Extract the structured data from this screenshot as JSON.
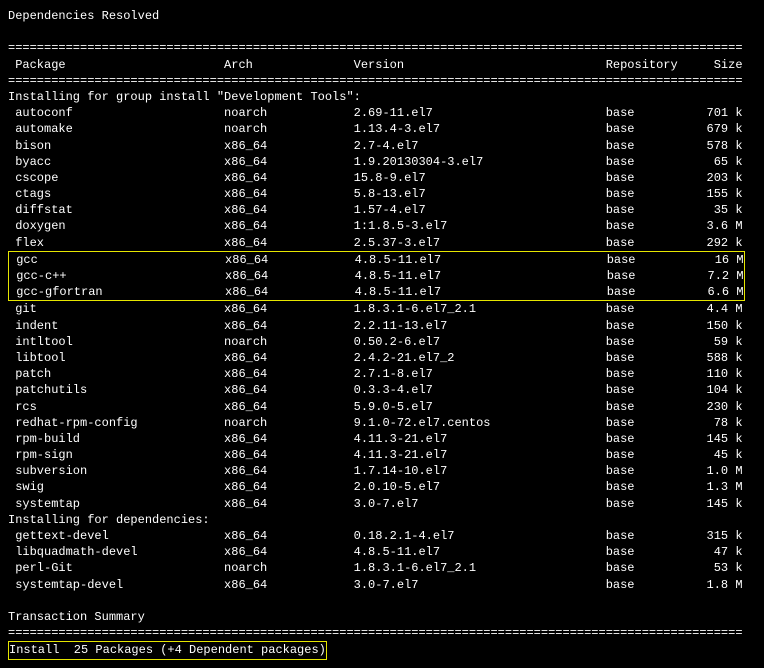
{
  "header": {
    "resolved": "Dependencies Resolved"
  },
  "columns": {
    "package": "Package",
    "arch": "Arch",
    "version": "Version",
    "repository": "Repository",
    "size": "Size"
  },
  "sections": {
    "install_group": "Installing for group install \"Development Tools\":",
    "install_deps": "Installing for dependencies:"
  },
  "packages_main": [
    {
      "name": "autoconf",
      "arch": "noarch",
      "version": "2.69-11.el7",
      "repo": "base",
      "size": "701 k"
    },
    {
      "name": "automake",
      "arch": "noarch",
      "version": "1.13.4-3.el7",
      "repo": "base",
      "size": "679 k"
    },
    {
      "name": "bison",
      "arch": "x86_64",
      "version": "2.7-4.el7",
      "repo": "base",
      "size": "578 k"
    },
    {
      "name": "byacc",
      "arch": "x86_64",
      "version": "1.9.20130304-3.el7",
      "repo": "base",
      "size": "65 k"
    },
    {
      "name": "cscope",
      "arch": "x86_64",
      "version": "15.8-9.el7",
      "repo": "base",
      "size": "203 k"
    },
    {
      "name": "ctags",
      "arch": "x86_64",
      "version": "5.8-13.el7",
      "repo": "base",
      "size": "155 k"
    },
    {
      "name": "diffstat",
      "arch": "x86_64",
      "version": "1.57-4.el7",
      "repo": "base",
      "size": "35 k"
    },
    {
      "name": "doxygen",
      "arch": "x86_64",
      "version": "1:1.8.5-3.el7",
      "repo": "base",
      "size": "3.6 M"
    },
    {
      "name": "flex",
      "arch": "x86_64",
      "version": "2.5.37-3.el7",
      "repo": "base",
      "size": "292 k"
    }
  ],
  "packages_highlight": [
    {
      "name": "gcc",
      "arch": "x86_64",
      "version": "4.8.5-11.el7",
      "repo": "base",
      "size": "16 M"
    },
    {
      "name": "gcc-c++",
      "arch": "x86_64",
      "version": "4.8.5-11.el7",
      "repo": "base",
      "size": "7.2 M"
    },
    {
      "name": "gcc-gfortran",
      "arch": "x86_64",
      "version": "4.8.5-11.el7",
      "repo": "base",
      "size": "6.6 M"
    }
  ],
  "packages_main2": [
    {
      "name": "git",
      "arch": "x86_64",
      "version": "1.8.3.1-6.el7_2.1",
      "repo": "base",
      "size": "4.4 M"
    },
    {
      "name": "indent",
      "arch": "x86_64",
      "version": "2.2.11-13.el7",
      "repo": "base",
      "size": "150 k"
    },
    {
      "name": "intltool",
      "arch": "noarch",
      "version": "0.50.2-6.el7",
      "repo": "base",
      "size": "59 k"
    },
    {
      "name": "libtool",
      "arch": "x86_64",
      "version": "2.4.2-21.el7_2",
      "repo": "base",
      "size": "588 k"
    },
    {
      "name": "patch",
      "arch": "x86_64",
      "version": "2.7.1-8.el7",
      "repo": "base",
      "size": "110 k"
    },
    {
      "name": "patchutils",
      "arch": "x86_64",
      "version": "0.3.3-4.el7",
      "repo": "base",
      "size": "104 k"
    },
    {
      "name": "rcs",
      "arch": "x86_64",
      "version": "5.9.0-5.el7",
      "repo": "base",
      "size": "230 k"
    },
    {
      "name": "redhat-rpm-config",
      "arch": "noarch",
      "version": "9.1.0-72.el7.centos",
      "repo": "base",
      "size": "78 k"
    },
    {
      "name": "rpm-build",
      "arch": "x86_64",
      "version": "4.11.3-21.el7",
      "repo": "base",
      "size": "145 k"
    },
    {
      "name": "rpm-sign",
      "arch": "x86_64",
      "version": "4.11.3-21.el7",
      "repo": "base",
      "size": "45 k"
    },
    {
      "name": "subversion",
      "arch": "x86_64",
      "version": "1.7.14-10.el7",
      "repo": "base",
      "size": "1.0 M"
    },
    {
      "name": "swig",
      "arch": "x86_64",
      "version": "2.0.10-5.el7",
      "repo": "base",
      "size": "1.3 M"
    },
    {
      "name": "systemtap",
      "arch": "x86_64",
      "version": "3.0-7.el7",
      "repo": "base",
      "size": "145 k"
    }
  ],
  "packages_deps": [
    {
      "name": "gettext-devel",
      "arch": "x86_64",
      "version": "0.18.2.1-4.el7",
      "repo": "base",
      "size": "315 k"
    },
    {
      "name": "libquadmath-devel",
      "arch": "x86_64",
      "version": "4.8.5-11.el7",
      "repo": "base",
      "size": "47 k"
    },
    {
      "name": "perl-Git",
      "arch": "noarch",
      "version": "1.8.3.1-6.el7_2.1",
      "repo": "base",
      "size": "53 k"
    },
    {
      "name": "systemtap-devel",
      "arch": "x86_64",
      "version": "3.0-7.el7",
      "repo": "base",
      "size": "1.8 M"
    }
  ],
  "footer": {
    "summary_title": "Transaction Summary",
    "install_line": "Install  25 Packages (+4 Dependent packages)"
  }
}
